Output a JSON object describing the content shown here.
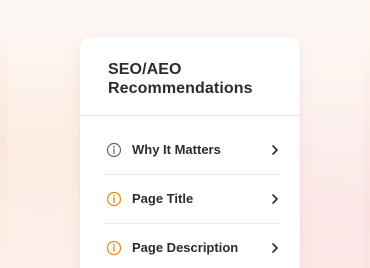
{
  "panel": {
    "title_line1": "SEO/AEO",
    "title_line2": "Recommendations"
  },
  "items": [
    {
      "label": "Why It Matters",
      "icon": "info-icon",
      "status": "neutral"
    },
    {
      "label": "Page Title",
      "icon": "info-icon",
      "status": "warning"
    },
    {
      "label": "Page Description",
      "icon": "info-icon",
      "status": "warning"
    }
  ],
  "colors": {
    "neutral_icon": "#6b6670",
    "warning_icon": "#f08c00",
    "text": "#2f2a30",
    "chevron": "#2f2a30"
  }
}
